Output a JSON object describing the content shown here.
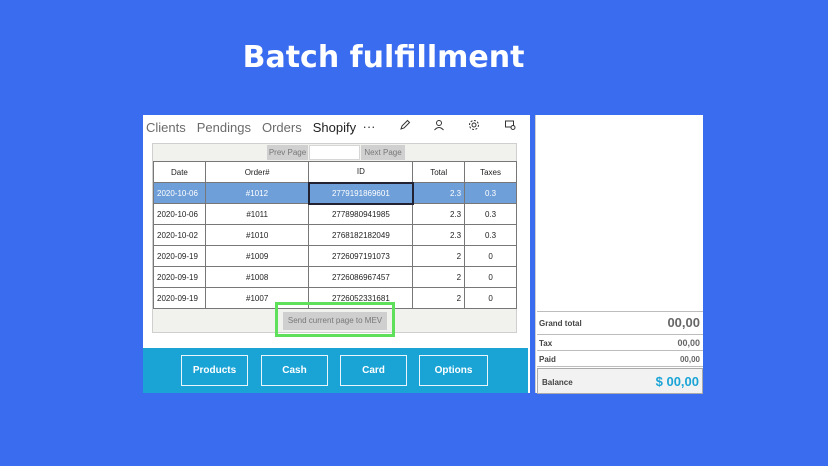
{
  "headline": "Batch fulfillment",
  "nav": {
    "tabs": [
      {
        "label": "Clients"
      },
      {
        "label": "Pendings"
      },
      {
        "label": "Orders"
      },
      {
        "label": "Shopify"
      }
    ],
    "icons": [
      "more-icon",
      "pencil-icon",
      "user-icon",
      "gear-icon",
      "receipt-icon"
    ]
  },
  "pager": {
    "prev_label": "Prev Page",
    "next_label": "Next Page",
    "page_value": ""
  },
  "table": {
    "headers": [
      "Date",
      "Order#",
      "ID",
      "Total",
      "Taxes"
    ],
    "rows": [
      {
        "date": "2020-10-06",
        "order": "#1012",
        "id": "2779191869601",
        "total": "2.3",
        "tax": "0.3"
      },
      {
        "date": "2020-10-06",
        "order": "#1011",
        "id": "2778980941985",
        "total": "2.3",
        "tax": "0.3"
      },
      {
        "date": "2020-10-02",
        "order": "#1010",
        "id": "2768182182049",
        "total": "2.3",
        "tax": "0.3"
      },
      {
        "date": "2020-09-19",
        "order": "#1009",
        "id": "2726097191073",
        "total": "2",
        "tax": "0"
      },
      {
        "date": "2020-09-19",
        "order": "#1008",
        "id": "2726086967457",
        "total": "2",
        "tax": "0"
      },
      {
        "date": "2020-09-19",
        "order": "#1007",
        "id": "2726052331681",
        "total": "2",
        "tax": "0"
      }
    ]
  },
  "send_button": "Send current page to  MEV",
  "actions": {
    "products": "Products",
    "cash": "Cash",
    "card": "Card",
    "options": "Options"
  },
  "totals": {
    "grand_total_label": "Grand total",
    "grand_total_value": "00,00",
    "tax_label": "Tax",
    "tax_value": "00,00",
    "paid_label": "Paid",
    "paid_value": "00,00",
    "balance_label": "Balance",
    "balance_value": "$ 00,00"
  },
  "colors": {
    "background": "#3a6cf0",
    "selected_row": "#6f9fd8",
    "action_bar": "#1aa4d6",
    "highlight": "#5fe05a",
    "balance_value": "#1aa4d6"
  }
}
